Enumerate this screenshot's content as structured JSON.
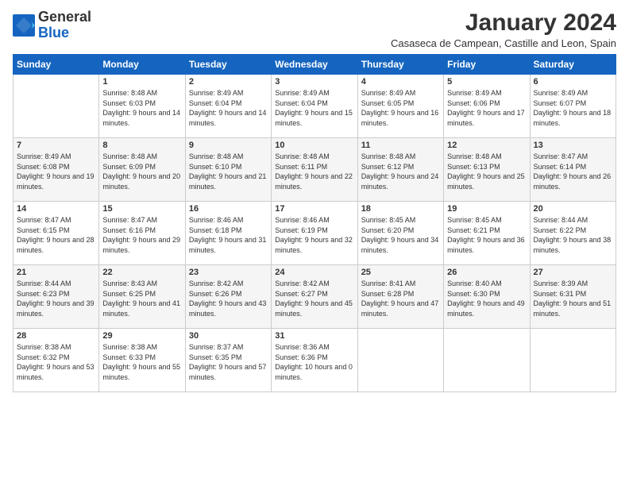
{
  "logo": {
    "line1": "General",
    "line2": "Blue"
  },
  "title": "January 2024",
  "subtitle": "Casaseca de Campean, Castille and Leon, Spain",
  "headers": [
    "Sunday",
    "Monday",
    "Tuesday",
    "Wednesday",
    "Thursday",
    "Friday",
    "Saturday"
  ],
  "weeks": [
    [
      {
        "day": "",
        "sunrise": "",
        "sunset": "",
        "daylight": ""
      },
      {
        "day": "1",
        "sunrise": "Sunrise: 8:48 AM",
        "sunset": "Sunset: 6:03 PM",
        "daylight": "Daylight: 9 hours and 14 minutes."
      },
      {
        "day": "2",
        "sunrise": "Sunrise: 8:49 AM",
        "sunset": "Sunset: 6:04 PM",
        "daylight": "Daylight: 9 hours and 14 minutes."
      },
      {
        "day": "3",
        "sunrise": "Sunrise: 8:49 AM",
        "sunset": "Sunset: 6:04 PM",
        "daylight": "Daylight: 9 hours and 15 minutes."
      },
      {
        "day": "4",
        "sunrise": "Sunrise: 8:49 AM",
        "sunset": "Sunset: 6:05 PM",
        "daylight": "Daylight: 9 hours and 16 minutes."
      },
      {
        "day": "5",
        "sunrise": "Sunrise: 8:49 AM",
        "sunset": "Sunset: 6:06 PM",
        "daylight": "Daylight: 9 hours and 17 minutes."
      },
      {
        "day": "6",
        "sunrise": "Sunrise: 8:49 AM",
        "sunset": "Sunset: 6:07 PM",
        "daylight": "Daylight: 9 hours and 18 minutes."
      }
    ],
    [
      {
        "day": "7",
        "sunrise": "Sunrise: 8:49 AM",
        "sunset": "Sunset: 6:08 PM",
        "daylight": "Daylight: 9 hours and 19 minutes."
      },
      {
        "day": "8",
        "sunrise": "Sunrise: 8:48 AM",
        "sunset": "Sunset: 6:09 PM",
        "daylight": "Daylight: 9 hours and 20 minutes."
      },
      {
        "day": "9",
        "sunrise": "Sunrise: 8:48 AM",
        "sunset": "Sunset: 6:10 PM",
        "daylight": "Daylight: 9 hours and 21 minutes."
      },
      {
        "day": "10",
        "sunrise": "Sunrise: 8:48 AM",
        "sunset": "Sunset: 6:11 PM",
        "daylight": "Daylight: 9 hours and 22 minutes."
      },
      {
        "day": "11",
        "sunrise": "Sunrise: 8:48 AM",
        "sunset": "Sunset: 6:12 PM",
        "daylight": "Daylight: 9 hours and 24 minutes."
      },
      {
        "day": "12",
        "sunrise": "Sunrise: 8:48 AM",
        "sunset": "Sunset: 6:13 PM",
        "daylight": "Daylight: 9 hours and 25 minutes."
      },
      {
        "day": "13",
        "sunrise": "Sunrise: 8:47 AM",
        "sunset": "Sunset: 6:14 PM",
        "daylight": "Daylight: 9 hours and 26 minutes."
      }
    ],
    [
      {
        "day": "14",
        "sunrise": "Sunrise: 8:47 AM",
        "sunset": "Sunset: 6:15 PM",
        "daylight": "Daylight: 9 hours and 28 minutes."
      },
      {
        "day": "15",
        "sunrise": "Sunrise: 8:47 AM",
        "sunset": "Sunset: 6:16 PM",
        "daylight": "Daylight: 9 hours and 29 minutes."
      },
      {
        "day": "16",
        "sunrise": "Sunrise: 8:46 AM",
        "sunset": "Sunset: 6:18 PM",
        "daylight": "Daylight: 9 hours and 31 minutes."
      },
      {
        "day": "17",
        "sunrise": "Sunrise: 8:46 AM",
        "sunset": "Sunset: 6:19 PM",
        "daylight": "Daylight: 9 hours and 32 minutes."
      },
      {
        "day": "18",
        "sunrise": "Sunrise: 8:45 AM",
        "sunset": "Sunset: 6:20 PM",
        "daylight": "Daylight: 9 hours and 34 minutes."
      },
      {
        "day": "19",
        "sunrise": "Sunrise: 8:45 AM",
        "sunset": "Sunset: 6:21 PM",
        "daylight": "Daylight: 9 hours and 36 minutes."
      },
      {
        "day": "20",
        "sunrise": "Sunrise: 8:44 AM",
        "sunset": "Sunset: 6:22 PM",
        "daylight": "Daylight: 9 hours and 38 minutes."
      }
    ],
    [
      {
        "day": "21",
        "sunrise": "Sunrise: 8:44 AM",
        "sunset": "Sunset: 6:23 PM",
        "daylight": "Daylight: 9 hours and 39 minutes."
      },
      {
        "day": "22",
        "sunrise": "Sunrise: 8:43 AM",
        "sunset": "Sunset: 6:25 PM",
        "daylight": "Daylight: 9 hours and 41 minutes."
      },
      {
        "day": "23",
        "sunrise": "Sunrise: 8:42 AM",
        "sunset": "Sunset: 6:26 PM",
        "daylight": "Daylight: 9 hours and 43 minutes."
      },
      {
        "day": "24",
        "sunrise": "Sunrise: 8:42 AM",
        "sunset": "Sunset: 6:27 PM",
        "daylight": "Daylight: 9 hours and 45 minutes."
      },
      {
        "day": "25",
        "sunrise": "Sunrise: 8:41 AM",
        "sunset": "Sunset: 6:28 PM",
        "daylight": "Daylight: 9 hours and 47 minutes."
      },
      {
        "day": "26",
        "sunrise": "Sunrise: 8:40 AM",
        "sunset": "Sunset: 6:30 PM",
        "daylight": "Daylight: 9 hours and 49 minutes."
      },
      {
        "day": "27",
        "sunrise": "Sunrise: 8:39 AM",
        "sunset": "Sunset: 6:31 PM",
        "daylight": "Daylight: 9 hours and 51 minutes."
      }
    ],
    [
      {
        "day": "28",
        "sunrise": "Sunrise: 8:38 AM",
        "sunset": "Sunset: 6:32 PM",
        "daylight": "Daylight: 9 hours and 53 minutes."
      },
      {
        "day": "29",
        "sunrise": "Sunrise: 8:38 AM",
        "sunset": "Sunset: 6:33 PM",
        "daylight": "Daylight: 9 hours and 55 minutes."
      },
      {
        "day": "30",
        "sunrise": "Sunrise: 8:37 AM",
        "sunset": "Sunset: 6:35 PM",
        "daylight": "Daylight: 9 hours and 57 minutes."
      },
      {
        "day": "31",
        "sunrise": "Sunrise: 8:36 AM",
        "sunset": "Sunset: 6:36 PM",
        "daylight": "Daylight: 10 hours and 0 minutes."
      },
      {
        "day": "",
        "sunrise": "",
        "sunset": "",
        "daylight": ""
      },
      {
        "day": "",
        "sunrise": "",
        "sunset": "",
        "daylight": ""
      },
      {
        "day": "",
        "sunrise": "",
        "sunset": "",
        "daylight": ""
      }
    ]
  ]
}
